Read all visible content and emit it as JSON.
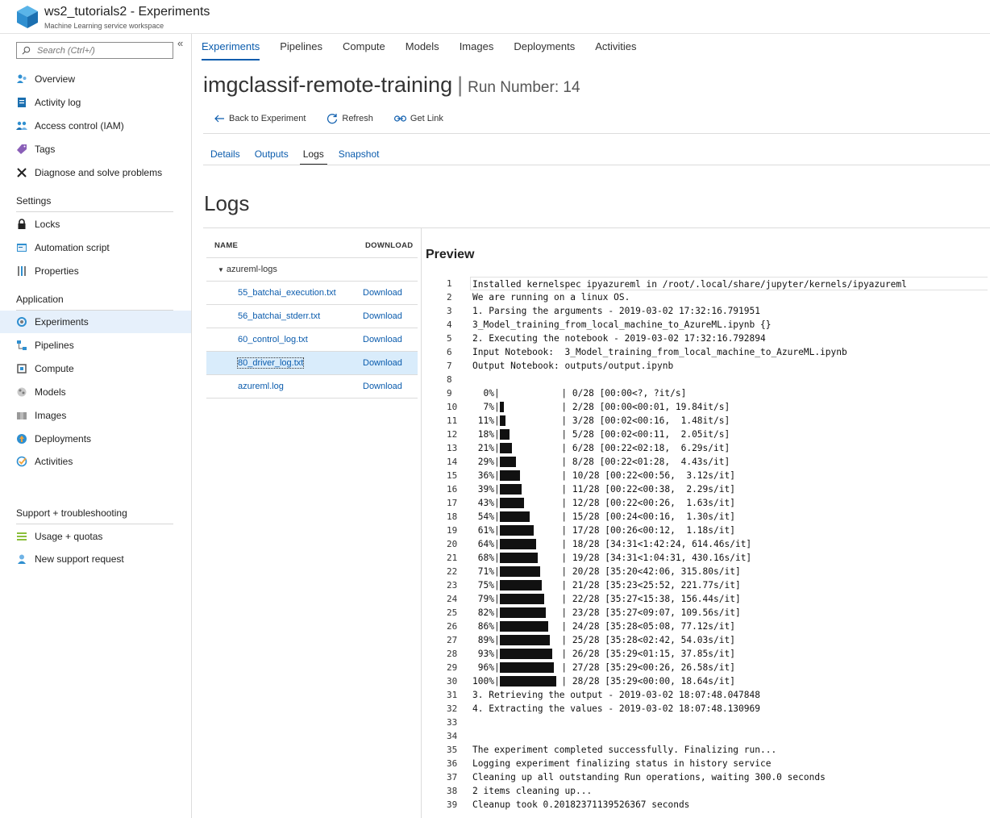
{
  "header": {
    "title": "ws2_tutorials2 - Experiments",
    "subtitle": "Machine Learning service workspace"
  },
  "sidebar": {
    "collapse_glyph": "«",
    "search_placeholder": "Search (Ctrl+/)",
    "top_items": [
      {
        "label": "Overview",
        "icon": "overview-icon"
      },
      {
        "label": "Activity log",
        "icon": "activity-log-icon"
      },
      {
        "label": "Access control (IAM)",
        "icon": "access-control-icon"
      },
      {
        "label": "Tags",
        "icon": "tag-icon"
      },
      {
        "label": "Diagnose and solve problems",
        "icon": "wrench-icon"
      }
    ],
    "settings_label": "Settings",
    "settings_items": [
      {
        "label": "Locks",
        "icon": "lock-icon"
      },
      {
        "label": "Automation script",
        "icon": "automation-script-icon"
      },
      {
        "label": "Properties",
        "icon": "properties-icon"
      }
    ],
    "application_label": "Application",
    "application_items": [
      {
        "label": "Experiments",
        "icon": "experiments-icon",
        "active": true
      },
      {
        "label": "Pipelines",
        "icon": "pipelines-icon"
      },
      {
        "label": "Compute",
        "icon": "compute-icon"
      },
      {
        "label": "Models",
        "icon": "models-icon"
      },
      {
        "label": "Images",
        "icon": "images-icon"
      },
      {
        "label": "Deployments",
        "icon": "deployments-icon"
      },
      {
        "label": "Activities",
        "icon": "activities-icon"
      }
    ],
    "support_label": "Support + troubleshooting",
    "support_items": [
      {
        "label": "Usage + quotas",
        "icon": "usage-quotas-icon"
      },
      {
        "label": "New support request",
        "icon": "support-request-icon"
      }
    ]
  },
  "main_tabs": [
    "Experiments",
    "Pipelines",
    "Compute",
    "Models",
    "Images",
    "Deployments",
    "Activities"
  ],
  "page": {
    "experiment_name": "imgclassif-remote-training",
    "separator": "|",
    "run_label": "Run Number: 14"
  },
  "toolbar": {
    "back": "Back to Experiment",
    "refresh": "Refresh",
    "get_link": "Get Link"
  },
  "sub_tabs": [
    "Details",
    "Outputs",
    "Logs",
    "Snapshot"
  ],
  "logs": {
    "title": "Logs",
    "col_name": "NAME",
    "col_download": "DOWNLOAD",
    "folder": "azureml-logs",
    "files": [
      {
        "name": "55_batchai_execution.txt",
        "download": "Download"
      },
      {
        "name": "56_batchai_stderr.txt",
        "download": "Download"
      },
      {
        "name": "60_control_log.txt",
        "download": "Download"
      },
      {
        "name": "80_driver_log.txt",
        "download": "Download",
        "selected": true
      },
      {
        "name": "azureml.log",
        "download": "Download"
      }
    ]
  },
  "preview": {
    "title": "Preview",
    "lines": [
      {
        "n": "1",
        "t": "Installed kernelspec ipyazureml in /root/.local/share/jupyter/kernels/ipyazureml"
      },
      {
        "n": "2",
        "t": "We are running on a linux OS."
      },
      {
        "n": "3",
        "t": "1. Parsing the arguments - 2019-03-02 17:32:16.791951"
      },
      {
        "n": "4",
        "t": "3_Model_training_from_local_machine_to_AzureML.ipynb {}"
      },
      {
        "n": "5",
        "t": "2. Executing the notebook - 2019-03-02 17:32:16.792894"
      },
      {
        "n": "6",
        "t": "Input Notebook:  3_Model_training_from_local_machine_to_AzureML.ipynb"
      },
      {
        "n": "7",
        "t": "Output Notebook: outputs/output.ipynb"
      },
      {
        "n": "8",
        "t": ""
      },
      {
        "n": "9",
        "pct": "  0%|",
        "done": 0,
        "rest": "| 0/28 [00:00<?, ?it/s]"
      },
      {
        "n": "10",
        "pct": "  7%|",
        "done": 2,
        "rest": "| 2/28 [00:00<00:01, 19.84it/s]"
      },
      {
        "n": "11",
        "pct": " 11%|",
        "done": 3,
        "rest": "| 3/28 [00:02<00:16,  1.48it/s]"
      },
      {
        "n": "12",
        "pct": " 18%|",
        "done": 5,
        "rest": "| 5/28 [00:02<00:11,  2.05it/s]"
      },
      {
        "n": "13",
        "pct": " 21%|",
        "done": 6,
        "rest": "| 6/28 [00:22<02:18,  6.29s/it]"
      },
      {
        "n": "14",
        "pct": " 29%|",
        "done": 8,
        "rest": "| 8/28 [00:22<01:28,  4.43s/it]"
      },
      {
        "n": "15",
        "pct": " 36%|",
        "done": 10,
        "rest": "| 10/28 [00:22<00:56,  3.12s/it]"
      },
      {
        "n": "16",
        "pct": " 39%|",
        "done": 11,
        "rest": "| 11/28 [00:22<00:38,  2.29s/it]"
      },
      {
        "n": "17",
        "pct": " 43%|",
        "done": 12,
        "rest": "| 12/28 [00:22<00:26,  1.63s/it]"
      },
      {
        "n": "18",
        "pct": " 54%|",
        "done": 15,
        "rest": "| 15/28 [00:24<00:16,  1.30s/it]"
      },
      {
        "n": "19",
        "pct": " 61%|",
        "done": 17,
        "rest": "| 17/28 [00:26<00:12,  1.18s/it]"
      },
      {
        "n": "20",
        "pct": " 64%|",
        "done": 18,
        "rest": "| 18/28 [34:31<1:42:24, 614.46s/it]"
      },
      {
        "n": "21",
        "pct": " 68%|",
        "done": 19,
        "rest": "| 19/28 [34:31<1:04:31, 430.16s/it]"
      },
      {
        "n": "22",
        "pct": " 71%|",
        "done": 20,
        "rest": "| 20/28 [35:20<42:06, 315.80s/it]"
      },
      {
        "n": "23",
        "pct": " 75%|",
        "done": 21,
        "rest": "| 21/28 [35:23<25:52, 221.77s/it]"
      },
      {
        "n": "24",
        "pct": " 79%|",
        "done": 22,
        "rest": "| 22/28 [35:27<15:38, 156.44s/it]"
      },
      {
        "n": "25",
        "pct": " 82%|",
        "done": 23,
        "rest": "| 23/28 [35:27<09:07, 109.56s/it]"
      },
      {
        "n": "26",
        "pct": " 86%|",
        "done": 24,
        "rest": "| 24/28 [35:28<05:08, 77.12s/it]"
      },
      {
        "n": "27",
        "pct": " 89%|",
        "done": 25,
        "rest": "| 25/28 [35:28<02:42, 54.03s/it]"
      },
      {
        "n": "28",
        "pct": " 93%|",
        "done": 26,
        "rest": "| 26/28 [35:29<01:15, 37.85s/it]"
      },
      {
        "n": "29",
        "pct": " 96%|",
        "done": 27,
        "rest": "| 27/28 [35:29<00:26, 26.58s/it]"
      },
      {
        "n": "30",
        "pct": "100%|",
        "done": 28,
        "rest": "| 28/28 [35:29<00:00, 18.64s/it]"
      },
      {
        "n": "31",
        "t": "3. Retrieving the output - 2019-03-02 18:07:48.047848"
      },
      {
        "n": "32",
        "t": "4. Extracting the values - 2019-03-02 18:07:48.130969"
      },
      {
        "n": "33",
        "t": ""
      },
      {
        "n": "34",
        "t": ""
      },
      {
        "n": "35",
        "t": "The experiment completed successfully. Finalizing run..."
      },
      {
        "n": "36",
        "t": "Logging experiment finalizing status in history service"
      },
      {
        "n": "37",
        "t": "Cleaning up all outstanding Run operations, waiting 300.0 seconds"
      },
      {
        "n": "38",
        "t": "2 items cleaning up..."
      },
      {
        "n": "39",
        "t": "Cleanup took 0.20182371139526367 seconds"
      }
    ]
  },
  "colors": {
    "accent": "#0b5cad",
    "active_row": "#e6f0fb",
    "selected_file": "#d9ecfb"
  }
}
